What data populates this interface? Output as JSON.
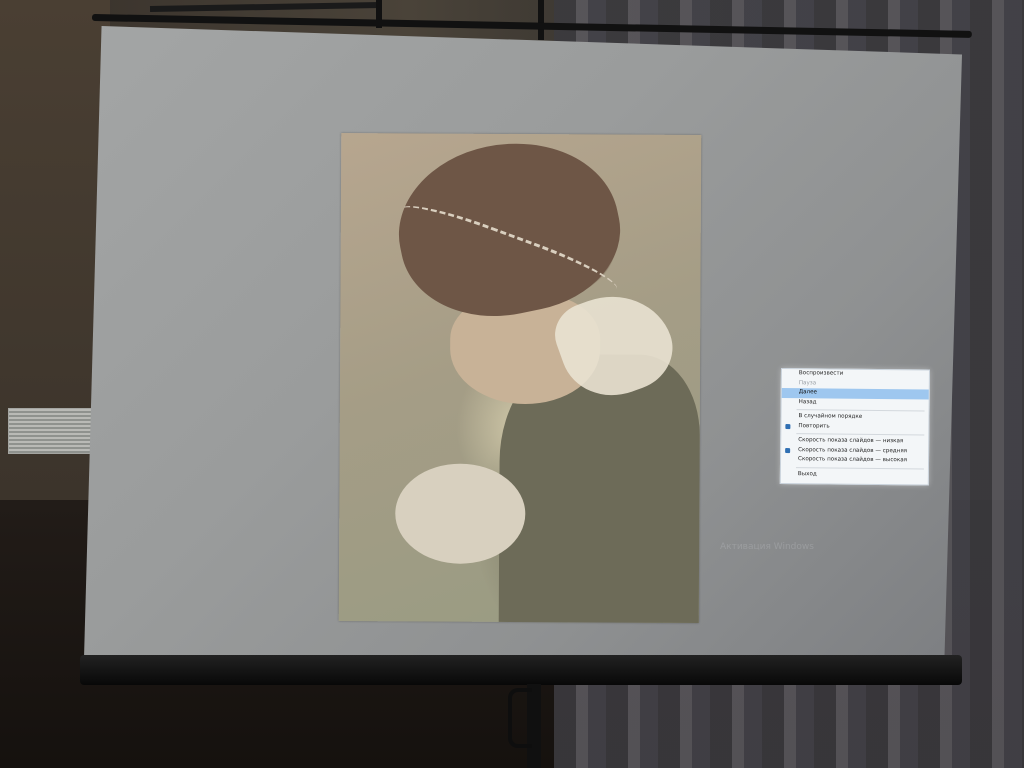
{
  "slideshow_menu": {
    "items": [
      {
        "id": "play",
        "label": "Воспроизвести",
        "disabled": false,
        "highlighted": false,
        "checked": false
      },
      {
        "id": "pause",
        "label": "Пауза",
        "disabled": true,
        "highlighted": false,
        "checked": false
      },
      {
        "id": "next",
        "label": "Далее",
        "disabled": false,
        "highlighted": true,
        "checked": false
      },
      {
        "id": "back",
        "label": "Назад",
        "disabled": false,
        "highlighted": false,
        "checked": false
      },
      {
        "separator": true
      },
      {
        "id": "shuffle",
        "label": "В случайном порядке",
        "disabled": false,
        "highlighted": false,
        "checked": false
      },
      {
        "id": "loop",
        "label": "Повторить",
        "disabled": false,
        "highlighted": false,
        "checked": true
      },
      {
        "separator": true
      },
      {
        "id": "speed-slow",
        "label": "Скорость показа слайдов — низкая",
        "disabled": false,
        "highlighted": false,
        "checked": false
      },
      {
        "id": "speed-medium",
        "label": "Скорость показа слайдов — средняя",
        "disabled": false,
        "highlighted": false,
        "checked": true
      },
      {
        "id": "speed-fast",
        "label": "Скорость показа слайдов — высокая",
        "disabled": false,
        "highlighted": false,
        "checked": false
      },
      {
        "separator": true
      },
      {
        "id": "exit",
        "label": "Выход",
        "disabled": false,
        "highlighted": false,
        "checked": false
      }
    ],
    "colors": {
      "highlight": "#9ec7ef",
      "check": "#2f6fb3",
      "background": "#f3f6f8"
    }
  },
  "watermark": {
    "title": "Активация Windows"
  },
  "slide": {
    "photo_icon": "photo-image"
  }
}
